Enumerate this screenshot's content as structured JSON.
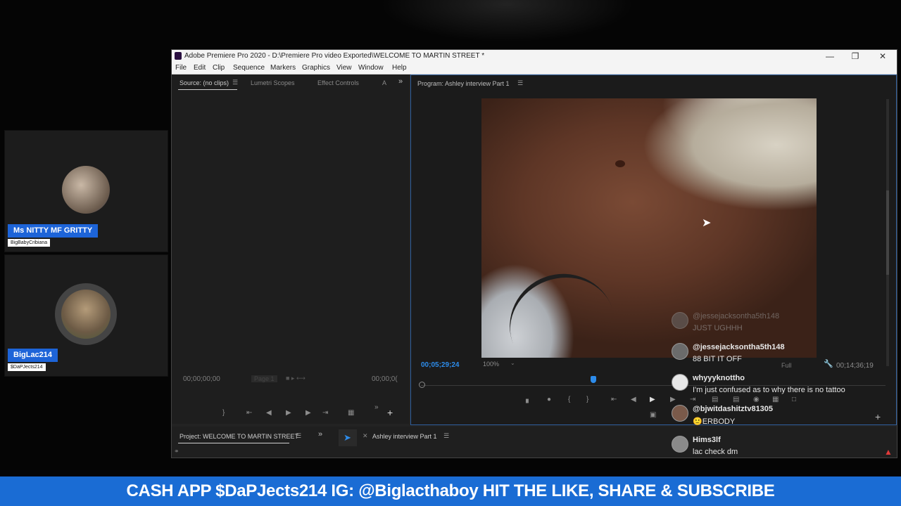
{
  "participants": [
    {
      "name": "Ms NITTY MF GRITTY",
      "handle": "BigBabyCribiana"
    },
    {
      "name": "BigLac214",
      "handle": "$DaPJects214"
    }
  ],
  "premiere": {
    "title": "Adobe Premiere Pro 2020 - D:\\Premiere Pro video Exported\\WELCOME TO MARTIN STREET *",
    "menu": [
      "File",
      "Edit",
      "Clip",
      "Sequence",
      "Markers",
      "Graphics",
      "View",
      "Window",
      "Help"
    ],
    "source_tabs": [
      "Source: (no clips)",
      "Lumetri Scopes",
      "Effect Controls",
      "A"
    ],
    "program_tab": "Program: Ashley interview Part 1",
    "source_tc_left": "00;00;00;00",
    "source_tc_right": "00;00;0(",
    "source_page": "Page 1",
    "program_tc_left": "00;05;29;24",
    "zoom": "100%",
    "resolution": "Full",
    "program_tc_right": "00;14;36;19",
    "project_tab": "Project: WELCOME TO MARTIN STREET",
    "sequence_tab": "Ashley interview Part 1"
  },
  "chat": [
    {
      "user": "@jessejacksontha5th148",
      "message": "JUST UGHHH",
      "faded": true
    },
    {
      "user": "@jessejacksontha5th148",
      "message": "88 BIT IT OFF",
      "faded": false
    },
    {
      "user": "whyyyknottho",
      "message": "I'm just confused as to why there is no tattoo",
      "faded": false
    },
    {
      "user": "@bjwitdashitztv81305",
      "message": "🙂ERBODY",
      "faded": false
    },
    {
      "user": "Hims3lf",
      "message": "lac check dm",
      "faded": false
    }
  ],
  "ticker": "CASH APP $DaPJects214 IG: @Biglacthaboy HIT THE LIKE, SHARE & SUBSCRIBE",
  "colors": {
    "name_tag": "#1d64d8",
    "ticker": "#1a6cd4",
    "timecode": "#2d8ceb"
  }
}
